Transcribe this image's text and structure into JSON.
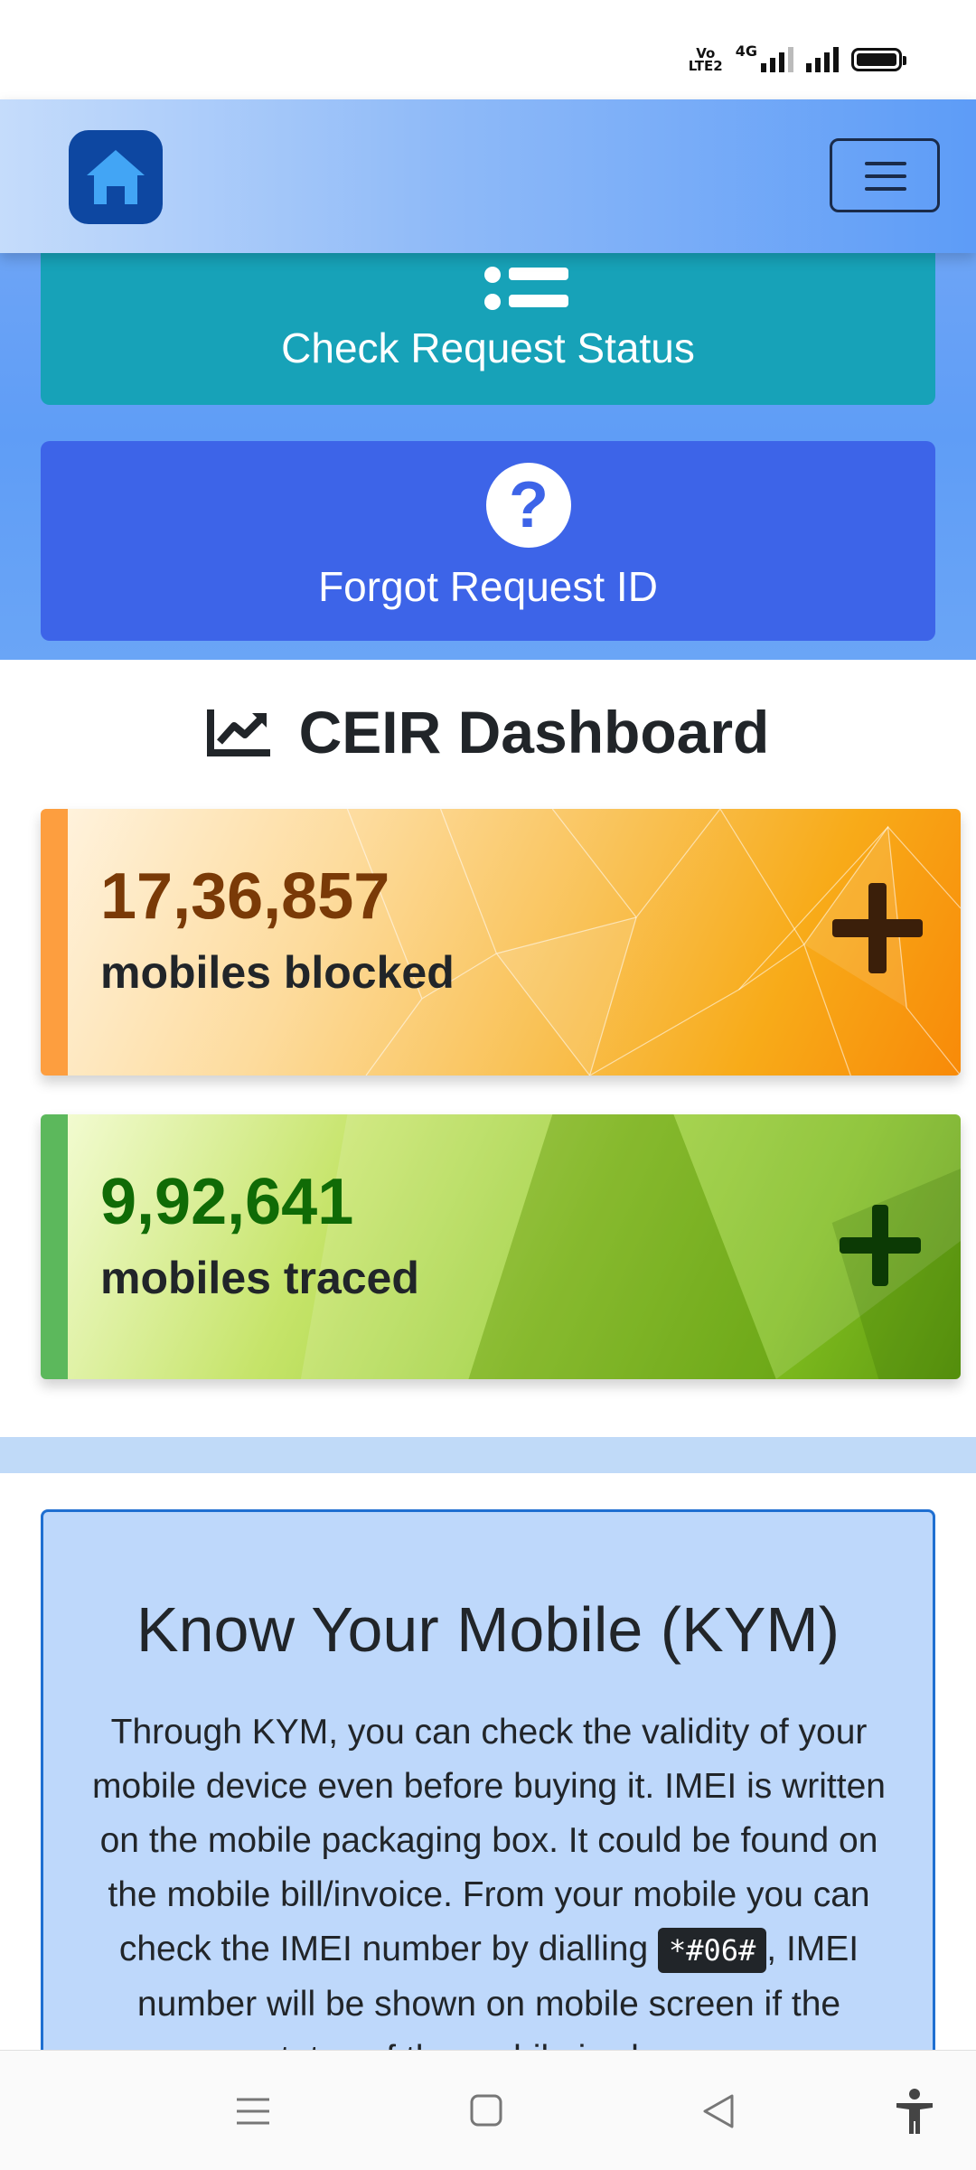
{
  "status_bar": {
    "volte_top": "Vo",
    "volte_bottom": "LTE2",
    "network": "4G",
    "battery_level": 1.0
  },
  "header": {
    "logo_icon": "home-icon",
    "menu_icon": "hamburger-menu-icon"
  },
  "actions": {
    "check_status": {
      "label": "Check Request Status",
      "icon": "list-icon"
    },
    "forgot_id": {
      "label": "Forgot Request ID",
      "icon": "question-circle-icon"
    }
  },
  "dashboard": {
    "title": "CEIR Dashboard",
    "icon": "chart-line-icon",
    "stats": [
      {
        "value": "17,36,857",
        "label": "mobiles blocked",
        "icon": "plus-icon",
        "accent": "#fd9e3f"
      },
      {
        "value": "9,92,641",
        "label": "mobiles traced",
        "icon": "plus-icon",
        "accent": "#5cb85c"
      }
    ]
  },
  "kym": {
    "title": "Know Your Mobile (KYM)",
    "text_before": "Through KYM, you can check the validity of your mobile device even before buying it. IMEI is written on the mobile packaging box. It could be found on the mobile bill/invoice. From your mobile you can check the IMEI number by dialling ",
    "code": "*#06#",
    "text_after": ", IMEI number will be shown on mobile screen if the status of the mobile is shown"
  },
  "system_nav": {
    "items": [
      "menu-lines-icon",
      "home-square-icon",
      "back-triangle-icon",
      "accessibility-icon"
    ]
  },
  "colors": {
    "brand_dark": "#0d47a1",
    "teal_button": "#17a2b8",
    "blue_button": "#3d64e8"
  }
}
